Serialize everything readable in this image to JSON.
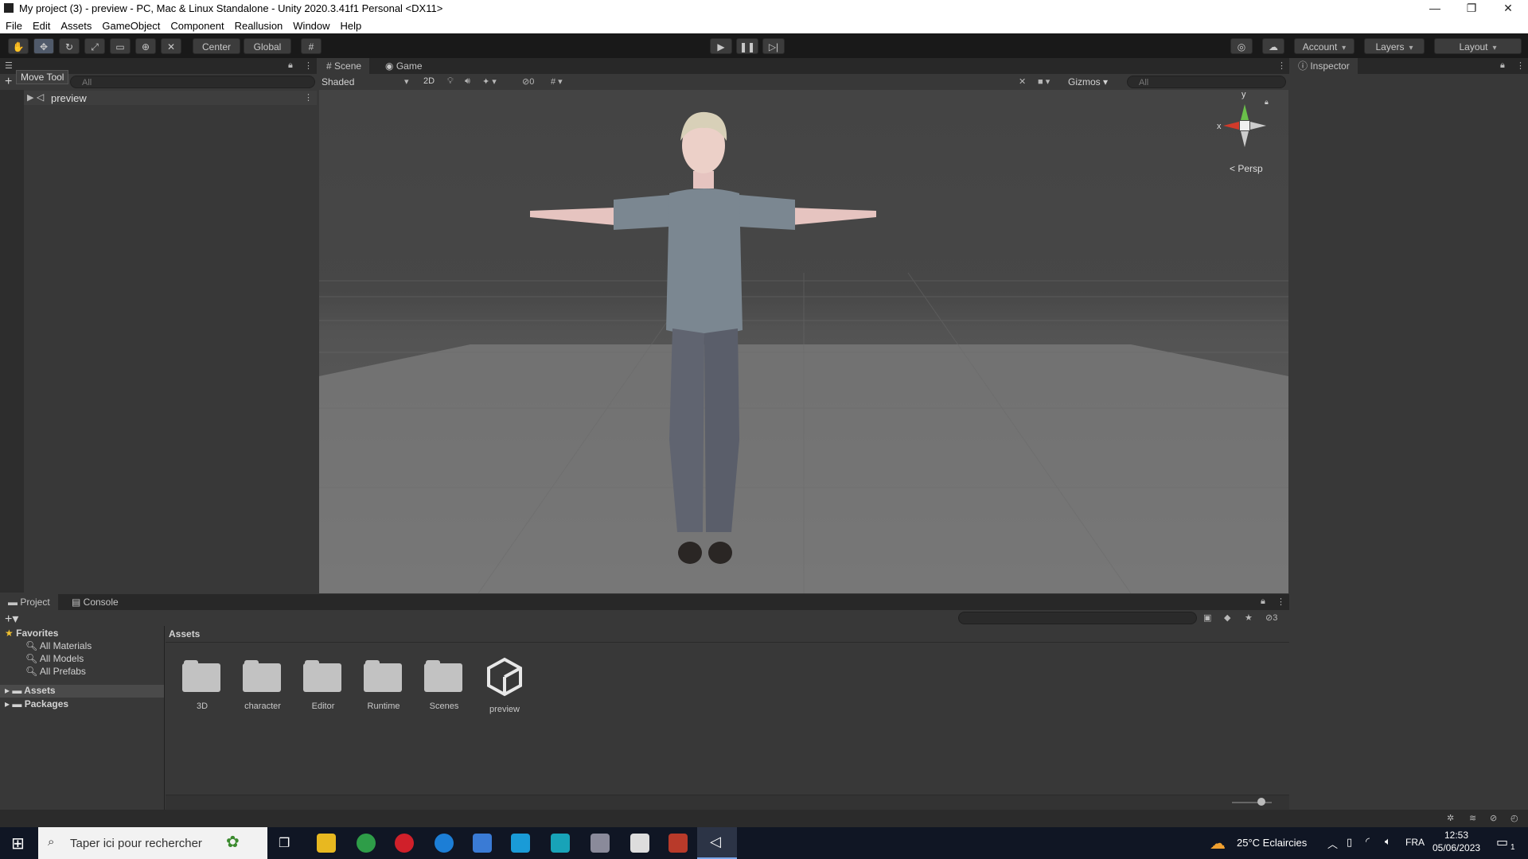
{
  "window": {
    "title": "My project (3) - preview - PC, Mac & Linux Standalone - Unity 2020.3.41f1 Personal <DX11>",
    "controls": [
      "—",
      "❐",
      "✕"
    ]
  },
  "menu": [
    "File",
    "Edit",
    "Assets",
    "GameObject",
    "Component",
    "Reallusion",
    "Window",
    "Help"
  ],
  "toolbar": {
    "pivot": "Center",
    "space": "Global",
    "account": "Account",
    "layers": "Layers",
    "layout": "Layout",
    "tooltip": "Move Tool"
  },
  "hierarchy": {
    "search_placeholder": "All",
    "scene_name": "preview"
  },
  "scene": {
    "tabs": [
      "Scene",
      "Game"
    ],
    "draw_mode": "Shaded",
    "toggle_2d": "2D",
    "hidden_count": "0",
    "gizmos": "Gizmos",
    "search_placeholder": "All",
    "gizmo_axes": {
      "y": "y",
      "x": "x"
    },
    "persp_label": "Persp"
  },
  "inspector": {
    "tab": "Inspector"
  },
  "project": {
    "tabs": [
      "Project",
      "Console"
    ],
    "favorites_label": "Favorites",
    "favorites": [
      "All Materials",
      "All Models",
      "All Prefabs"
    ],
    "roots": [
      "Assets",
      "Packages"
    ],
    "breadcrumb": "Assets",
    "hidden_count": "3",
    "items": [
      {
        "name": "3D",
        "type": "folder"
      },
      {
        "name": "character",
        "type": "folder"
      },
      {
        "name": "Editor",
        "type": "folder"
      },
      {
        "name": "Runtime",
        "type": "folder"
      },
      {
        "name": "Scenes",
        "type": "folder"
      },
      {
        "name": "preview",
        "type": "unity-scene"
      }
    ]
  },
  "taskbar": {
    "search_placeholder": "Taper ici pour rechercher",
    "weather": "25°C Eclaircies",
    "language": "FRA",
    "time": "12:53",
    "date": "05/06/2023",
    "notification_count": "1"
  }
}
